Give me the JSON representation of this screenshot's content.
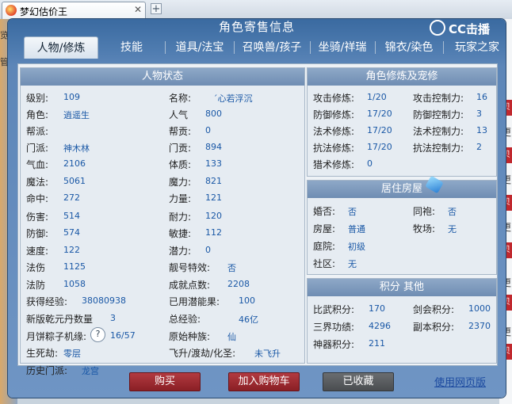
{
  "browser": {
    "tab_title": "梦幻估价王",
    "close": "✕",
    "new_tab": "+"
  },
  "background": {
    "left_fragments": [
      "览",
      "管"
    ],
    "right_label": "更",
    "right_btn": "贝"
  },
  "window": {
    "title": "角色寄售信息",
    "logo": "CC击播"
  },
  "tabs": [
    "人物/修炼",
    "技能",
    "道具/法宝",
    "召唤兽/孩子",
    "坐骑/祥瑞",
    "锦衣/染色",
    "玩家之家"
  ],
  "status": {
    "header": "人物状态",
    "left": [
      {
        "label": "级别:",
        "value": "109"
      },
      {
        "label": "角色:",
        "value": "逍遥生"
      },
      {
        "label": "帮派:",
        "value": ""
      },
      {
        "label": "门派:",
        "value": "神木林"
      },
      {
        "label": "气血:",
        "value": "2106"
      },
      {
        "label": "魔法:",
        "value": "5061"
      },
      {
        "label": "命中:",
        "value": "272"
      },
      {
        "label": "伤害:",
        "value": "514"
      },
      {
        "label": "防御:",
        "value": "574"
      },
      {
        "label": "速度:",
        "value": "122"
      },
      {
        "label": "法伤",
        "value": "1125"
      },
      {
        "label": "法防",
        "value": "1058"
      },
      {
        "label": "获得经验:",
        "value": "38080938"
      },
      {
        "label": "新版乾元丹数量",
        "value": "3"
      },
      {
        "label": "月饼粽子机缘:",
        "value": "16/57"
      },
      {
        "label": "生死劫:",
        "value": "零层"
      },
      {
        "label": "历史门派:",
        "value": "龙宫"
      }
    ],
    "right": [
      {
        "label": "名称:",
        "value": "´心若浮沉"
      },
      {
        "label": "人气",
        "value": "800"
      },
      {
        "label": "帮贡:",
        "value": "0"
      },
      {
        "label": "门贡:",
        "value": "894"
      },
      {
        "label": "体质:",
        "value": "133"
      },
      {
        "label": "魔力:",
        "value": "821"
      },
      {
        "label": "力量:",
        "value": "121"
      },
      {
        "label": "耐力:",
        "value": "120"
      },
      {
        "label": "敏捷:",
        "value": "112"
      },
      {
        "label": "潜力:",
        "value": "0"
      },
      {
        "label": "靓号特效:",
        "value": "否"
      },
      {
        "label": "成就点数:",
        "value": "2208"
      },
      {
        "label": "已用潜能果:",
        "value": "100"
      },
      {
        "label": "总经验:",
        "value": "46亿"
      },
      {
        "label": "原始种族:",
        "value": "仙"
      },
      {
        "label": "飞升/渡劫/化圣:",
        "value": "未飞升"
      }
    ],
    "help_icon": "?"
  },
  "cultivation": {
    "header": "角色修炼及宠修",
    "left": [
      {
        "label": "攻击修炼:",
        "value": "1/20"
      },
      {
        "label": "防御修炼:",
        "value": "17/20"
      },
      {
        "label": "法术修炼:",
        "value": "17/20"
      },
      {
        "label": "抗法修炼:",
        "value": "17/20"
      },
      {
        "label": "猎术修炼:",
        "value": "0"
      }
    ],
    "right": [
      {
        "label": "攻击控制力:",
        "value": "16"
      },
      {
        "label": "防御控制力:",
        "value": "3"
      },
      {
        "label": "法术控制力:",
        "value": "13"
      },
      {
        "label": "抗法控制力:",
        "value": "2"
      }
    ]
  },
  "house": {
    "header": "居住房屋",
    "left": [
      {
        "label": "婚否:",
        "value": "否"
      },
      {
        "label": "房屋:",
        "value": "普通"
      },
      {
        "label": "庭院:",
        "value": "初级"
      },
      {
        "label": "社区:",
        "value": "无"
      }
    ],
    "right": [
      {
        "label": "同袍:",
        "value": "否"
      },
      {
        "label": "牧场:",
        "value": "无"
      }
    ]
  },
  "points": {
    "header": "积分 其他",
    "left": [
      {
        "label": "比武积分:",
        "value": "170"
      },
      {
        "label": "三界功绩:",
        "value": "4296"
      },
      {
        "label": "神器积分:",
        "value": "211"
      }
    ],
    "right": [
      {
        "label": "剑会积分:",
        "value": "1000"
      },
      {
        "label": "副本积分:",
        "value": "2370"
      }
    ]
  },
  "actions": {
    "buy": "购买",
    "add_cart": "加入购物车",
    "favorited": "已收藏",
    "web_version": "使用网页版"
  }
}
